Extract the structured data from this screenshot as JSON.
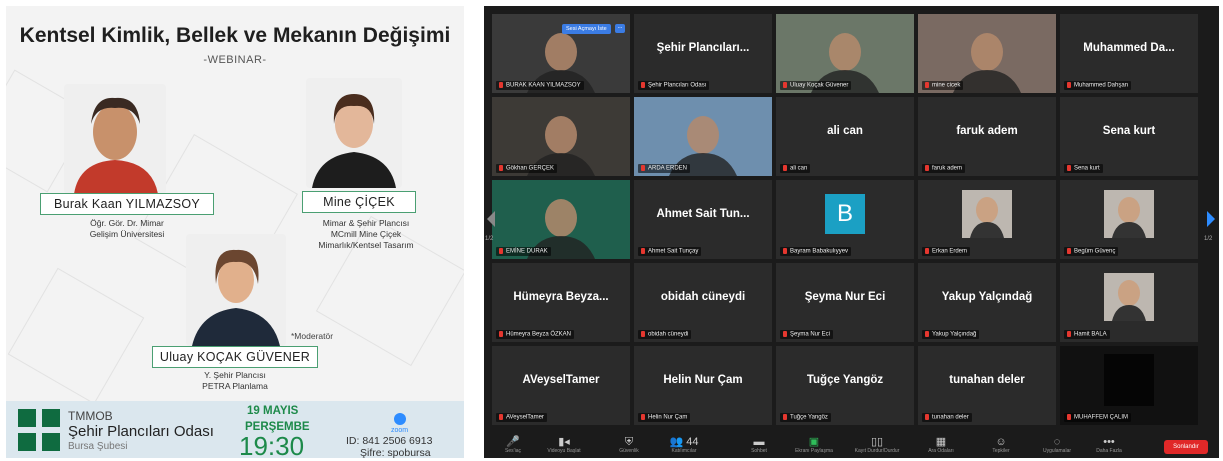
{
  "poster": {
    "title": "Kentsel Kimlik, Bellek ve Mekanın Değişimi",
    "subtitle": "-WEBINAR-",
    "speaker1": {
      "name": "Burak Kaan YILMAZSOY",
      "role_line1": "Öğr. Gör. Dr. Mimar",
      "role_line2": "Gelişim Üniversitesi"
    },
    "speaker2": {
      "name": "Mine ÇİÇEK",
      "role_line1": "Mimar & Şehir Plancısı",
      "role_line2": "MCmill Mine Çiçek",
      "role_line3": "Mimarlık/Kentsel Tasarım"
    },
    "moderator_note": "*Moderatör",
    "speaker3": {
      "name": "Uluay KOÇAK GÜVENER",
      "role_line1": "Y. Şehir Plancısı",
      "role_line2": "PETRA Planlama"
    },
    "org": {
      "line1": "TMMOB",
      "line2": "Şehir Plancıları Odası",
      "line3": "Bursa Şubesi"
    },
    "date_line1": "19 MAYIS",
    "date_line2": "PERŞEMBE",
    "time": "19:30",
    "zoom_label": "zoom",
    "zoom_id": "ID: 841 2506 6913",
    "zoom_password": "Şifre: spobursa",
    "colors": {
      "accent": "#1d8a4a",
      "logo": "#0f6b40",
      "footer": "#dbe7ee"
    }
  },
  "zoom": {
    "speaker_badge": "Sesi Açmayı İste",
    "speaker_badge_more": "...",
    "tiles": [
      {
        "label": "BURAK KAAN YILMAZSOY",
        "name": "",
        "video": true,
        "bg": "#3a3a3a"
      },
      {
        "label": "Şehir Plancıları Odası",
        "name": "Şehir Plancıları...",
        "video": false
      },
      {
        "label": "Uluay Koçak Güvener",
        "name": "",
        "video": true,
        "bg": "#6b7768",
        "active": true
      },
      {
        "label": "mine cicek",
        "name": "",
        "video": true,
        "bg": "#7a6a62"
      },
      {
        "label": "Muhammed Dahşan",
        "name": "Muhammed Da...",
        "video": false
      },
      {
        "label": "Gökhan GERÇEK",
        "name": "",
        "video": true,
        "bg": "#3d3a36"
      },
      {
        "label": "ARDA ERDEN",
        "name": "",
        "video": true,
        "bg": "#6e8fae"
      },
      {
        "label": "ali can",
        "name": "ali can",
        "video": false
      },
      {
        "label": "faruk adem",
        "name": "faruk adem",
        "video": false
      },
      {
        "label": "Sena kurt",
        "name": "Sena kurt",
        "video": false
      },
      {
        "label": "EMİNE DURAK",
        "name": "",
        "video": true,
        "bg": "#1f5f4d"
      },
      {
        "label": "Ahmet Sait Tunçay",
        "name": "Ahmet Sait Tun...",
        "video": false
      },
      {
        "label": "Bayram Babakulıyyev",
        "name": "B",
        "video": false,
        "avatar": true
      },
      {
        "label": "Erkan Erdem",
        "name": "",
        "video": true,
        "bg": "#2b2b2b",
        "thumb": true
      },
      {
        "label": "Begüm Güvenç",
        "name": "",
        "video": true,
        "bg": "#2b2b2b",
        "thumb": true
      },
      {
        "label": "Hümeyra Beyza ÖZKAN",
        "name": "Hümeyra Beyza...",
        "video": false
      },
      {
        "label": "obidah cüneydi",
        "name": "obidah cüneydi",
        "video": false
      },
      {
        "label": "Şeyma Nur Eci",
        "name": "Şeyma Nur Eci",
        "video": false
      },
      {
        "label": "Yakup Yalçındağ",
        "name": "Yakup Yalçındağ",
        "video": false
      },
      {
        "label": "Hamit BALA",
        "name": "",
        "video": true,
        "bg": "#2b2b2b",
        "thumb": true
      },
      {
        "label": "AVeyselTamer",
        "name": "AVeyselTamer",
        "video": false
      },
      {
        "label": "Helin Nur Çam",
        "name": "Helin Nur Çam",
        "video": false
      },
      {
        "label": "Tuğçe Yangöz",
        "name": "Tuğçe Yangöz",
        "video": false
      },
      {
        "label": "tunahan deler",
        "name": "tunahan deler",
        "video": false
      },
      {
        "label": "MUHAFFEM ÇALIM",
        "name": "",
        "video": true,
        "bg": "#111111",
        "blackbox": true
      }
    ],
    "left_page": "1/2",
    "right_page": "1/2",
    "toolbar": [
      {
        "icon": "mic-icon",
        "glyph": "🎤",
        "label": "Ses'iaç"
      },
      {
        "icon": "video-icon",
        "glyph": "▮◂",
        "label": "Videoyu Başlat"
      },
      {
        "icon": "shield-icon",
        "glyph": "⛨",
        "label": "Güvenlik"
      },
      {
        "icon": "participants-icon",
        "glyph": "👥",
        "label": "Katılımcılar",
        "count": "44"
      },
      {
        "icon": "chat-icon",
        "glyph": "▬",
        "label": "Sohbet"
      },
      {
        "icon": "share-screen-icon",
        "glyph": "▣",
        "label": "Ekranı Paylaşma"
      },
      {
        "icon": "captions-icon",
        "glyph": "▯▯",
        "label": "Kayıt Durdur/Durdur"
      },
      {
        "icon": "breakout-icon",
        "glyph": "▦",
        "label": "Ara Odaları"
      },
      {
        "icon": "reactions-icon",
        "glyph": "☺",
        "label": "Tepkiler"
      },
      {
        "icon": "apps-icon",
        "glyph": "◌",
        "label": "Uygulamalar"
      },
      {
        "icon": "more-icon",
        "glyph": "•••",
        "label": "Daha Fazla"
      }
    ],
    "end_label": "Sonlandır"
  }
}
